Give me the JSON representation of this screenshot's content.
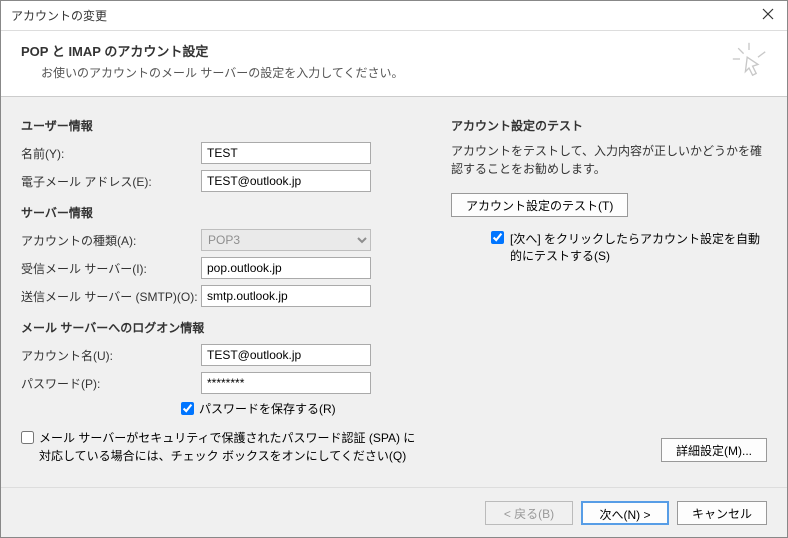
{
  "dialog": {
    "title": "アカウントの変更"
  },
  "header": {
    "title": "POP と IMAP のアカウント設定",
    "subtitle": "お使いのアカウントのメール サーバーの設定を入力してください。"
  },
  "sections": {
    "user_info": "ユーザー情報",
    "server_info": "サーバー情報",
    "logon_info": "メール サーバーへのログオン情報",
    "test_info": "アカウント設定のテスト"
  },
  "labels": {
    "name": "名前(Y):",
    "email": "電子メール アドレス(E):",
    "account_type": "アカウントの種類(A):",
    "incoming": "受信メール サーバー(I):",
    "outgoing": "送信メール サーバー (SMTP)(O):",
    "account_name": "アカウント名(U):",
    "password": "パスワード(P):",
    "save_password": "パスワードを保存する(R)",
    "spa": "メール サーバーがセキュリティで保護されたパスワード認証 (SPA) に対応している場合には、チェック ボックスをオンにしてください(Q)",
    "test_text": "アカウントをテストして、入力内容が正しいかどうかを確認することをお勧めします。",
    "auto_test": "[次へ] をクリックしたらアカウント設定を自動的にテストする(S)"
  },
  "values": {
    "name": "TEST",
    "email": "TEST@outlook.jp",
    "account_type": "POP3",
    "incoming": "pop.outlook.jp",
    "outgoing": "smtp.outlook.jp",
    "account_name": "TEST@outlook.jp",
    "password": "********"
  },
  "buttons": {
    "test": "アカウント設定のテスト(T)",
    "detail": "詳細設定(M)...",
    "back": "< 戻る(B)",
    "next": "次へ(N) >",
    "cancel": "キャンセル"
  }
}
